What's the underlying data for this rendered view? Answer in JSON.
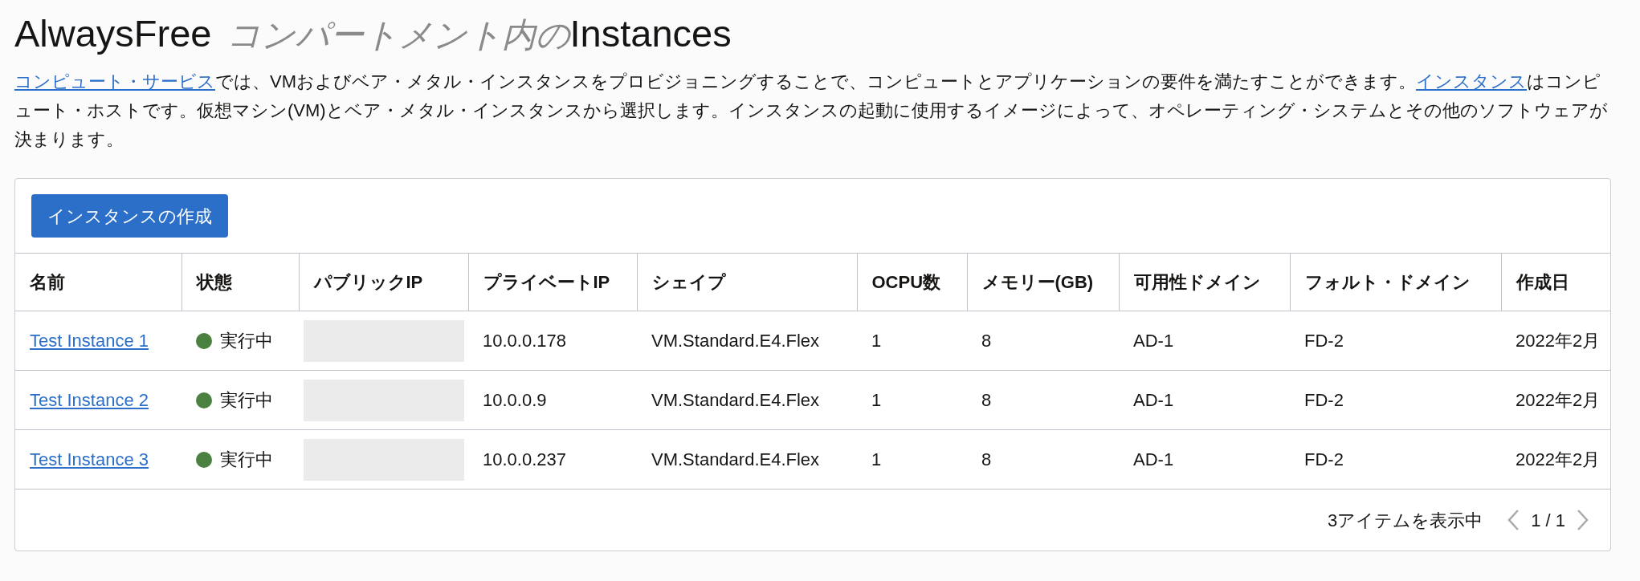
{
  "title": {
    "prefix": "AlwaysFree",
    "compartment": "コンパートメント内の",
    "suffix": "Instances"
  },
  "description": [
    {
      "kind": "link",
      "text": "コンピュート・サービス"
    },
    {
      "kind": "text",
      "text": "では、VMおよびベア・メタル・インスタンスをプロビジョニングすることで、コンピュートとアプリケーションの要件を満たすことができます。"
    },
    {
      "kind": "link",
      "text": "インスタンス"
    },
    {
      "kind": "text",
      "text": "はコンピュート・ホストです。仮想マシン(VM)とベア・メタル・インスタンスから選択します。インスタンスの起動に使用するイメージによって、オペレーティング・システムとその他のソフトウェアが決まります。"
    }
  ],
  "create_button": "インスタンスの作成",
  "table": {
    "columns": [
      "名前",
      "状態",
      "パブリックIP",
      "プライベートIP",
      "シェイプ",
      "OCPU数",
      "メモリー(GB)",
      "可用性ドメイン",
      "フォルト・ドメイン",
      "作成日"
    ],
    "rows": [
      {
        "name": "Test Instance 1",
        "state": "実行中",
        "private_ip": "10.0.0.178",
        "shape": "VM.Standard.E4.Flex",
        "ocpu": "1",
        "memory": "8",
        "ad": "AD-1",
        "fd": "FD-2",
        "created": "2022年2月"
      },
      {
        "name": "Test Instance 2",
        "state": "実行中",
        "private_ip": "10.0.0.9",
        "shape": "VM.Standard.E4.Flex",
        "ocpu": "1",
        "memory": "8",
        "ad": "AD-1",
        "fd": "FD-2",
        "created": "2022年2月"
      },
      {
        "name": "Test Instance 3",
        "state": "実行中",
        "private_ip": "10.0.0.237",
        "shape": "VM.Standard.E4.Flex",
        "ocpu": "1",
        "memory": "8",
        "ad": "AD-1",
        "fd": "FD-2",
        "created": "2022年2月"
      }
    ]
  },
  "footer": {
    "count": "3アイテムを表示中",
    "page": "1 / 1"
  }
}
